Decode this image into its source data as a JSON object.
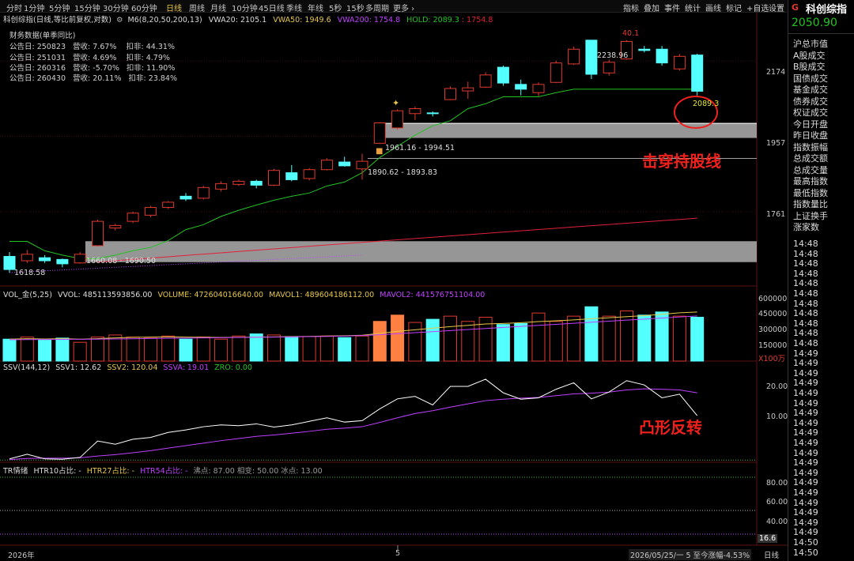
{
  "toolbar": {
    "tabs": [
      "分时",
      "1分钟",
      "5分钟",
      "15分钟",
      "30分钟",
      "60分钟",
      "日线",
      "周线",
      "月线",
      "10分钟",
      "45日线",
      "季线",
      "年线",
      "5秒",
      "15秒",
      "多周期",
      "更多 ›"
    ],
    "active_tab": "日线",
    "tools": [
      "指标",
      "叠加",
      "事件",
      "统计",
      "画线",
      "标记",
      "+自选",
      "设置"
    ]
  },
  "header": {
    "title": "科创综指(日线,等比前复权,对数)",
    "ma_label": "M6(8,20,50,200,13)",
    "vwa20": "VWA20: 2105.1",
    "vwa50": "VWA50: 1949.6",
    "vwa200": "VWA200: 1754.8",
    "hold": "HOLD: 2089.3",
    "hold2": ": 1754.8"
  },
  "financials": {
    "title": "财务数据(单季同比)",
    "rows": [
      "公告日: 250823   营收: 7.67%    扣非: 44.31%",
      "公告日: 251031   营收: 4.69%    扣非: 4.79%",
      "公告日: 260316   营收: -5.70%   扣非: 11.90%",
      "公告日: 260430   营收: 20.11%   扣非: 23.84%"
    ]
  },
  "price_labels": {
    "high_count": "40.1",
    "high": "2238.96",
    "hold_point": "2089.3",
    "zone_upper": "1961.16 - 1994.51",
    "zone_mid": "1890.62 - 1893.83",
    "zone_lower": "1660.08 - 1690.50",
    "low": "1618.58"
  },
  "price_axis": [
    "2174",
    "1957",
    "1761"
  ],
  "annotations": {
    "break_line": "击穿持股线",
    "convex_reversal": "凸形反转"
  },
  "volume_header": {
    "name": "VOL_金(5,25)",
    "vvol": "VVOL: 485113593856.00",
    "volume": "VOLUME: 472604016640.00",
    "mavol1": "MAVOL1: 489604186112.00",
    "mavol2": "MAVOL2: 441576751104.00"
  },
  "volume_axis": [
    "600000",
    "450000",
    "300000",
    "150000"
  ],
  "volume_unit": "X100万",
  "ssv_header": {
    "name": "SSV(144,12)",
    "ssv1": "SSV1: 12.62",
    "ssv2": "SSV2: 120.04",
    "ssva": "SSVA: 19.01",
    "zro": "ZRO: 0.00"
  },
  "ssv_axis": [
    "20.00",
    "10.00"
  ],
  "tr_header": {
    "name": "TR情绪",
    "htr10": "HTR10占比: -",
    "htr27": "HTR27占比: -",
    "htr54": "HTR54占比: -",
    "levels": "沸点: 87.00  相变: 50.00  冰点: 13.00"
  },
  "tr_axis": [
    "80.00",
    "60.00",
    "40.00"
  ],
  "tr_current": "16.6",
  "xaxis": {
    "year": "2026年",
    "month": "5",
    "date_range": "2026/05/25/一 5 至今涨幅-4.53%",
    "period": "日线"
  },
  "sidebar": {
    "index_code": "G",
    "index_name": "科创综指",
    "price": "2050.90",
    "items": [
      "沪总市值",
      "A股成交",
      "B股成交",
      "国债成交",
      "基金成交",
      "债券成交",
      "权证成交",
      "今日开盘",
      "昨日收盘",
      "指数振幅",
      "总成交额",
      "总成交量",
      "最高指数",
      "最低指数",
      "指数量比",
      "上证换手",
      "涨家数"
    ],
    "times": [
      "14:48",
      "14:48",
      "14:48",
      "14:48",
      "14:48",
      "14:48",
      "14:48",
      "14:48",
      "14:48",
      "14:48",
      "14:48",
      "14:49",
      "14:49",
      "14:49",
      "14:49",
      "14:49",
      "14:49",
      "14:49",
      "14:49",
      "14:49",
      "14:49",
      "14:49",
      "14:49",
      "14:49",
      "14:49",
      "14:49",
      "14:49",
      "14:49",
      "14:49",
      "14:49",
      "14:50",
      "14:50"
    ]
  },
  "colors": {
    "up": "#e0392f",
    "down": "#54ffff",
    "highlight": "#ff8040",
    "hold": "#22c322",
    "vwa200": "#e0203a",
    "vwa_low": "#c040ff",
    "accent": "#e6c64a"
  },
  "chart_data": [
    {
      "type": "candlestick",
      "ohlc": [
        [
          1655,
          1665,
          1618,
          1625
        ],
        [
          1645,
          1670,
          1640,
          1660
        ],
        [
          1652,
          1658,
          1640,
          1645
        ],
        [
          1648,
          1650,
          1630,
          1638
        ],
        [
          1640,
          1665,
          1638,
          1660
        ],
        [
          1680,
          1742,
          1678,
          1738
        ],
        [
          1722,
          1732,
          1716,
          1728
        ],
        [
          1738,
          1762,
          1734,
          1758
        ],
        [
          1753,
          1776,
          1748,
          1772
        ],
        [
          1772,
          1788,
          1768,
          1785
        ],
        [
          1800,
          1808,
          1788,
          1793
        ],
        [
          1795,
          1826,
          1792,
          1822
        ],
        [
          1818,
          1838,
          1812,
          1832
        ],
        [
          1830,
          1842,
          1826,
          1838
        ],
        [
          1838,
          1842,
          1820,
          1828
        ],
        [
          1828,
          1870,
          1826,
          1866
        ],
        [
          1860,
          1880,
          1838,
          1842
        ],
        [
          1845,
          1872,
          1840,
          1868
        ],
        [
          1868,
          1898,
          1866,
          1893
        ],
        [
          1888,
          1902,
          1876,
          1878
        ],
        [
          1870,
          1910,
          1842,
          1890
        ],
        [
          1938,
          1996,
          1936,
          1994
        ],
        [
          1980,
          2032,
          1975,
          2028
        ],
        [
          2020,
          2040,
          2002,
          2034
        ],
        [
          2022,
          2026,
          2012,
          2020
        ],
        [
          2060,
          2098,
          2058,
          2092
        ],
        [
          2085,
          2112,
          2062,
          2094
        ],
        [
          2096,
          2140,
          2094,
          2132
        ],
        [
          2155,
          2160,
          2100,
          2108
        ],
        [
          2104,
          2118,
          2072,
          2090
        ],
        [
          2080,
          2110,
          2070,
          2104
        ],
        [
          2110,
          2175,
          2108,
          2168
        ],
        [
          2165,
          2218,
          2162,
          2210
        ],
        [
          2238,
          2239,
          2120,
          2134
        ],
        [
          2138,
          2178,
          2130,
          2170
        ],
        [
          2180,
          2238,
          2178,
          2234
        ],
        [
          2210,
          2220,
          2200,
          2206
        ],
        [
          2210,
          2220,
          2160,
          2168
        ],
        [
          2150,
          2195,
          2145,
          2188
        ],
        [
          2192,
          2196,
          2072,
          2084
        ]
      ],
      "y_scale": "log",
      "ylim": [
        1595,
        2290
      ]
    },
    {
      "type": "bar",
      "volume": [
        210000,
        230000,
        200000,
        220000,
        180000,
        230000,
        250000,
        230000,
        220000,
        240000,
        210000,
        230000,
        210000,
        240000,
        260000,
        250000,
        235000,
        235000,
        240000,
        225000,
        240000,
        380000,
        440000,
        370000,
        400000,
        430000,
        380000,
        420000,
        350000,
        360000,
        460000,
        380000,
        430000,
        520000,
        430000,
        480000,
        440000,
        470000,
        430000,
        420000
      ],
      "mavol1": [
        210000,
        215000,
        212000,
        215000,
        210000,
        215000,
        222000,
        227000,
        230000,
        232000,
        230000,
        228000,
        226000,
        228000,
        230000,
        232000,
        234000,
        236000,
        240000,
        243000,
        248000,
        265000,
        285000,
        300000,
        315000,
        330000,
        342000,
        355000,
        360000,
        368000,
        378000,
        386000,
        394000,
        405000,
        415000,
        425000,
        435000,
        448000,
        462000,
        470000
      ],
      "mavol2": [
        205000,
        206000,
        207000,
        208000,
        209000,
        210000,
        212000,
        214000,
        216000,
        218000,
        220000,
        222000,
        224000,
        226000,
        228000,
        230000,
        232000,
        234000,
        236000,
        240000,
        245000,
        252000,
        262000,
        272000,
        282000,
        292000,
        302000,
        312000,
        322000,
        332000,
        342000,
        352000,
        362000,
        372000,
        382000,
        392000,
        402000,
        412000,
        422000,
        432000
      ],
      "ylim": [
        0,
        620000
      ]
    },
    {
      "type": "line",
      "ssv1": [
        0.5,
        1.8,
        0.5,
        0.4,
        0.9,
        5.5,
        4.6,
        6.0,
        6.5,
        7.9,
        8.6,
        9.5,
        10.0,
        9.8,
        10.3,
        9.4,
        10.0,
        11.0,
        12.0,
        10.8,
        11.2,
        14.5,
        17.3,
        18.0,
        15.6,
        20.8,
        20.8,
        22.8,
        19.0,
        17.2,
        17.6,
        20.0,
        21.8,
        17.3,
        19.2,
        22.4,
        21.2,
        17.6,
        18.6,
        12.6
      ],
      "ssva": [
        0.3,
        0.6,
        0.7,
        0.7,
        0.8,
        1.3,
        1.7,
        2.2,
        2.8,
        3.5,
        4.2,
        4.9,
        5.6,
        6.2,
        6.8,
        7.2,
        7.7,
        8.2,
        8.8,
        9.1,
        9.5,
        10.7,
        12.0,
        13.2,
        14.0,
        15.0,
        15.9,
        16.8,
        17.2,
        17.5,
        17.7,
        18.2,
        18.7,
        18.9,
        19.2,
        19.8,
        20.1,
        20.0,
        19.8,
        19.0
      ],
      "ylim": [
        0,
        25
      ]
    }
  ]
}
